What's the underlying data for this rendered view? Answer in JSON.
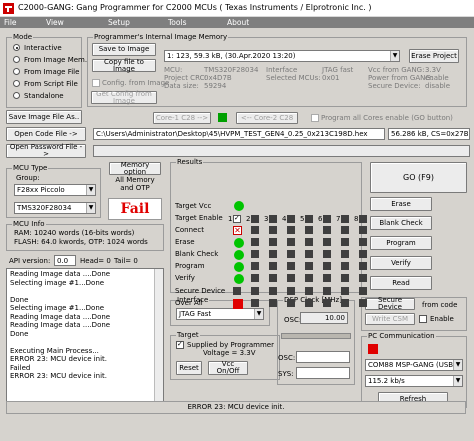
{
  "window": {
    "title": "C2000-GANG:  Gang Programmer for C2000  MCUs ( Texas Instruments / Elprotronic Inc. )"
  },
  "menu": [
    "File",
    "View",
    "Setup",
    "Tools",
    "About"
  ],
  "mode": {
    "label": "Mode",
    "options": [
      "Interactive",
      "From Image Mem.",
      "From Image File",
      "From Script File",
      "Standalone"
    ],
    "selected": 0
  },
  "image_memory": {
    "label": "Programmer's Internal Image Memory",
    "save_label": "Save to Image",
    "copy_label": "Copy file to Image",
    "config_label": "Config. from Image",
    "get_config_label": "Get Config from Image",
    "selected": "1:  123,  59.3 kB,  (30.Apr.2020  13:20)",
    "erase_label": "Erase Project",
    "info": {
      "mcu_l": "MCU:",
      "mcu_v": "TMS320F28034",
      "crc_l": "Project CRC:",
      "crc_v": "0x4D7B",
      "data_l": "Data size:",
      "data_v": "59294",
      "iface_l": "Interface",
      "iface_v": "JTAG fast",
      "sel_l": "Selected MCUs:",
      "sel_v": "0x01",
      "vcc_l": "Vcc from GANG:",
      "vcc_v": "3.3V",
      "pwr_l": "Power from GANG:",
      "pwr_v": "enable",
      "sec_l": "Secure Device:",
      "sec_v": "disable"
    }
  },
  "save_image_file_label": "Save Image File As..",
  "core1_label": "Core-1 C28 -->",
  "core2_label": "<-- Core-2 C28",
  "program_all_cores": "Program all Cores enable (GO button)",
  "open_code_label": "Open Code File ->",
  "code_path": "C:\\Users\\Administrator\\Desktop\\45\\HVPM_TEST_GEN4_0.25_0x213C198D.hex",
  "code_info": "56.286 kB, CS=0x27B21A2F",
  "open_password_label": "Open Password File ->",
  "mcu_type": {
    "label": "MCU Type",
    "group_label": "Group:",
    "group_value": "F28xx Piccolo",
    "mcu_value": "TMS320F28034"
  },
  "memory_option": "Memory option",
  "memory_mode": "All Memory and OTP",
  "result_text": "Fail",
  "mcu_info": {
    "label": "MCU Info",
    "ram": "RAM: 10240 words (16-bits words)",
    "flash": "FLASH: 64.0 kwords,  OTP: 1024 words"
  },
  "api": {
    "version_l": "API version:",
    "version_v": "0.0",
    "head_l": "Head= 0",
    "tail_l": "Tail= 0"
  },
  "log": [
    "Reading Image data ....Done",
    "Selecting image #1...Done",
    "",
    "Done",
    "Selecting image #1...Done",
    "Reading Image data ....Done",
    "Reading Image data ....Done",
    "Done",
    "",
    "Executing Main Process...",
    "ERROR 23: MCU device init.",
    "Failed",
    "ERROR 23: MCU device init."
  ],
  "results": {
    "label": "Results",
    "rows": [
      "Target Vcc",
      "Target Enable",
      "Connect",
      "Erase",
      "Blank Check",
      "Program",
      "Verify",
      "Secure Device",
      "Over All"
    ],
    "enable_numbers": [
      "1",
      "2",
      "3",
      "4",
      "5",
      "6",
      "7",
      "8"
    ],
    "target_enable": [
      true,
      false,
      false,
      false,
      false,
      false,
      false,
      false
    ]
  },
  "actions": {
    "go": "GO   (F9)",
    "erase": "Erase",
    "blank": "Blank Check",
    "program": "Program",
    "verify": "Verify",
    "read": "Read"
  },
  "interface": {
    "label": "Interface",
    "value": "JTAG Fast"
  },
  "target": {
    "label": "Target",
    "supplied": "Supplied by Programmer",
    "voltage": "Voltage = 3.3V",
    "reset": "Reset",
    "vcc": "Vcc On/Off"
  },
  "dsp": {
    "label": "DSP Clock [MHz]",
    "osc_l": "OSC:",
    "osc_v": "10.00",
    "osc2_l": "OSC:",
    "sys_l": "SYS:"
  },
  "secure": {
    "button": "Secure Device",
    "from_code": "from code",
    "write_csm": "Write CSM",
    "enable": "Enable"
  },
  "pc_comm": {
    "label": "PC Communication",
    "port": "COM88   MSP-GANG (USB)",
    "baud": "115.2 kb/s",
    "refresh": "Refresh"
  },
  "status": "ERROR 23: MCU device init."
}
